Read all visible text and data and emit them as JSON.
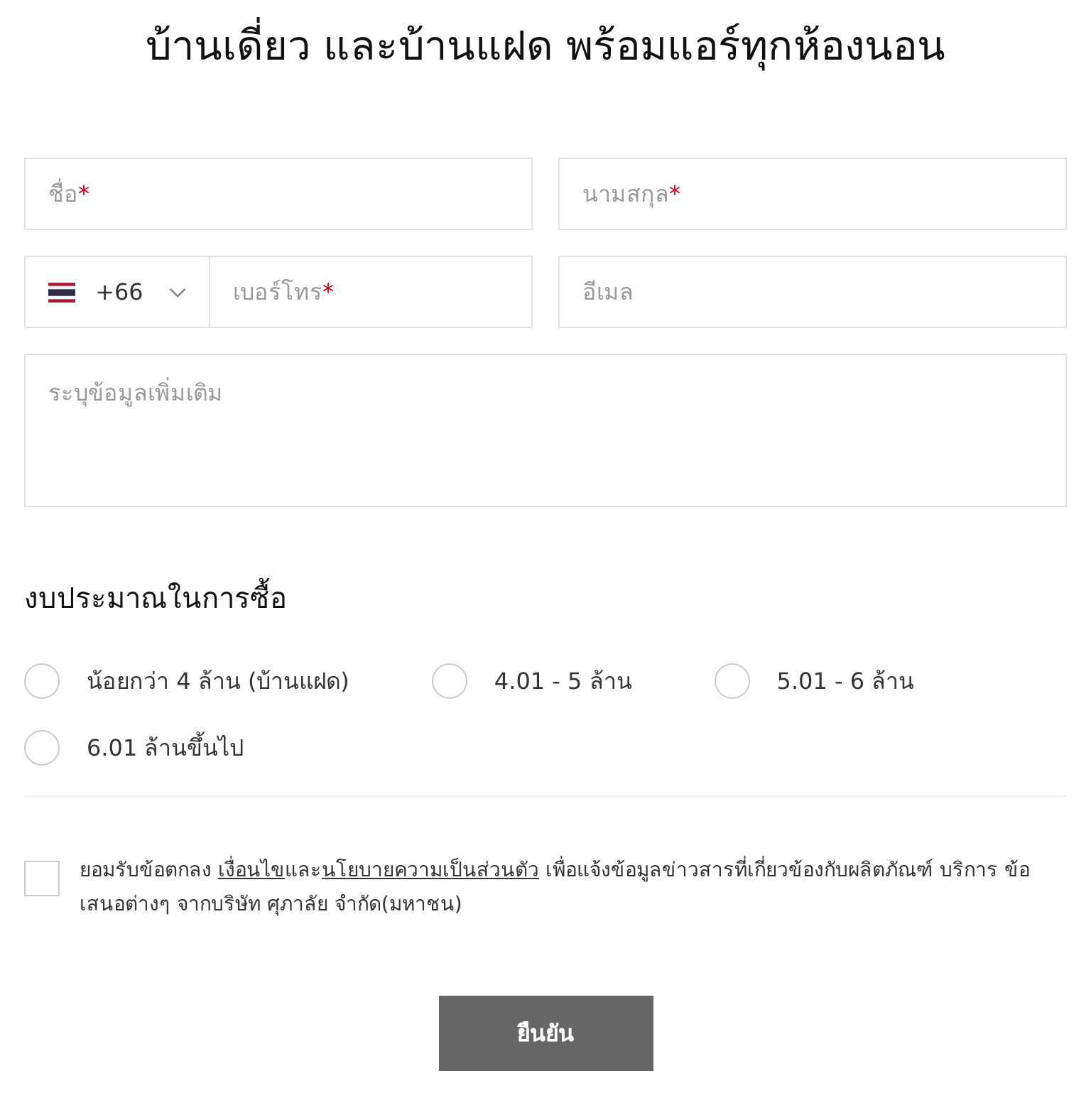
{
  "title": "บ้านเดี่ยว และบ้านแฝด พร้อมแอร์ทุกห้องนอน",
  "fields": [
    {
      "kind": "text",
      "placeholder": "ชื่อ",
      "required_mark": "*"
    },
    {
      "kind": "text",
      "placeholder": "นามสกุล",
      "required_mark": "*"
    },
    {
      "kind": "phone",
      "country_code": "+66",
      "placeholder": "เบอร์โทร",
      "required_mark": "*"
    },
    {
      "kind": "text",
      "placeholder": "อีเมล"
    },
    {
      "kind": "textarea",
      "placeholder": "ระบุข้อมูลเพิ่มเติม"
    }
  ],
  "budget": {
    "heading": "งบประมาณในการซื้อ",
    "options": [
      {
        "label": "น้อยกว่า 4 ล้าน (บ้านแฝด)",
        "selected": false
      },
      {
        "label": "4.01 - 5 ล้าน",
        "selected": false
      },
      {
        "label": "5.01 - 6 ล้าน",
        "selected": false
      },
      {
        "label": "6.01 ล้านขึ้นไป",
        "selected": false
      }
    ]
  },
  "consent": {
    "checked": false,
    "parts": [
      {
        "kind": "text",
        "text": "ยอมรับข้อตกลง "
      },
      {
        "kind": "link",
        "text": "เงื่อนไข"
      },
      {
        "kind": "text",
        "text": "และ"
      },
      {
        "kind": "link",
        "text": "นโยบายความเป็นส่วนตัว"
      },
      {
        "kind": "text",
        "text": " เพื่อแจ้งข้อมูลข่าวสารที่เกี่ยวข้องกับผลิตภัณฑ์ บริการ ข้อเสนอต่างๆ จากบริษัท ศุภาลัย จำกัด(มหาชน)"
      }
    ]
  },
  "submit": "ยืนยัน"
}
